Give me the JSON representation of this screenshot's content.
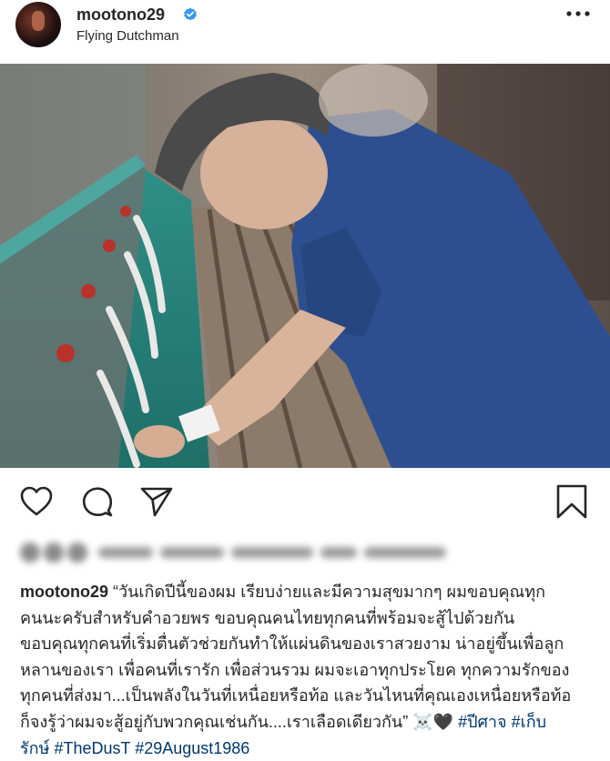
{
  "post": {
    "username": "mootono29",
    "location": "Flying Dutchman",
    "avatar_icon": "profile-avatar",
    "verified_icon": "verified-badge-icon",
    "more_icon": "more-options-icon"
  },
  "photo": {
    "icon": "photo"
  },
  "actions": {
    "like_icon": "heart-icon",
    "comment_icon": "comment-icon",
    "share_icon": "send-icon",
    "save_icon": "bookmark-icon"
  },
  "caption": {
    "username": "mootono29",
    "line1": " “วันเกิดปีนี้ของผม เรียบง่ายและมีความสุขมากๆ ผมขอบคุณทุก",
    "line2": "คนนะครับสำหรับคำอวยพร ขอบคุณคนไทยทุกคนที่พร้อมจะสู้ไปด้วยกัน",
    "line3": "ขอบคุณทุกคนที่เริ่มตื่นตัวช่วยกันทำให้แผ่นดินของเราสวยงาม น่าอยู่ขึ้นเพื่อลูก",
    "line4": "หลานของเรา เพื่อคนที่เรารัก เพื่อส่วนรวม ผมจะเอาทุกประโยค ทุกความรักของ",
    "line5": "ทุกคนที่ส่งมา...เป็นพลังในวันที่เหนื่อยหรือท้อ และวันไหนที่คุณเองเหนื่อยหรือท้อ",
    "line6_text": "ก็จงรู้ว่าผมจะสู้อยู่กับพวกคุณเช่นกัน....เราเลือดเดียวกัน” ",
    "emoji": "☠️🖤",
    "hashtag1": "#ปีศาจ",
    "hashtag2_part1": "#เก็บ",
    "hashtag2_part2": "รักษ์",
    "hashtag3": "#TheDusT",
    "hashtag4": "#29August1986"
  },
  "colors": {
    "link": "#00376b",
    "verified": "#3897f0",
    "text": "#262626"
  }
}
